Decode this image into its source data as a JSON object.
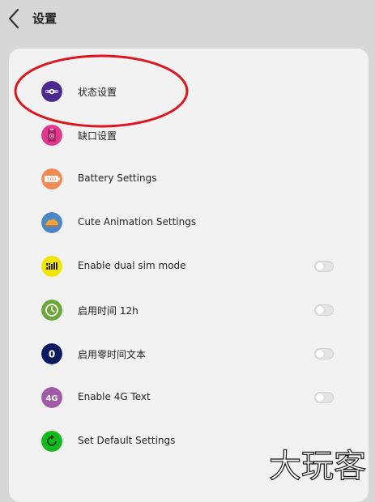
{
  "header": {
    "title": "设置",
    "back_icon": "chevron-left-icon"
  },
  "colors": {
    "page_background": "#d7d7d7",
    "card_background": "#f2f2f2",
    "highlight_oval": "#e0141e"
  },
  "settings": {
    "items": [
      {
        "label": "状态设置",
        "icon": "status-bar-icon",
        "icon_color": "#4a2a8e",
        "has_toggle": false
      },
      {
        "label": "缺口设置",
        "icon": "notch-icon",
        "icon_color": "#e2378e",
        "has_toggle": false
      },
      {
        "label": "Battery Settings",
        "icon": "battery-icon",
        "icon_text": "100",
        "icon_color": "#f28a52",
        "has_toggle": false
      },
      {
        "label": "Cute Animation Settings",
        "icon": "animation-icon",
        "icon_color": "#4d86c7",
        "has_toggle": false
      },
      {
        "label": "Enable dual sim mode",
        "icon": "dual-sim-icon",
        "icon_color": "#f2e600",
        "has_toggle": true,
        "enabled": false
      },
      {
        "label": "启用时间 12h",
        "icon": "clock-icon",
        "icon_color": "#6aa63a",
        "has_toggle": true,
        "enabled": false
      },
      {
        "label": "启用零时间文本",
        "icon": "zero-icon",
        "icon_text": "0",
        "icon_color": "#0c1a5e",
        "has_toggle": true,
        "enabled": false
      },
      {
        "label": "Enable 4G Text",
        "icon": "4g-icon",
        "icon_text": "4G",
        "icon_color": "#a05aa8",
        "has_toggle": true,
        "enabled": false
      },
      {
        "label": "Set Default Settings",
        "icon": "reset-icon",
        "icon_color": "#12b81c",
        "has_toggle": false
      }
    ]
  },
  "watermark": {
    "text": "大玩客",
    "kind": "watermark-logo"
  }
}
